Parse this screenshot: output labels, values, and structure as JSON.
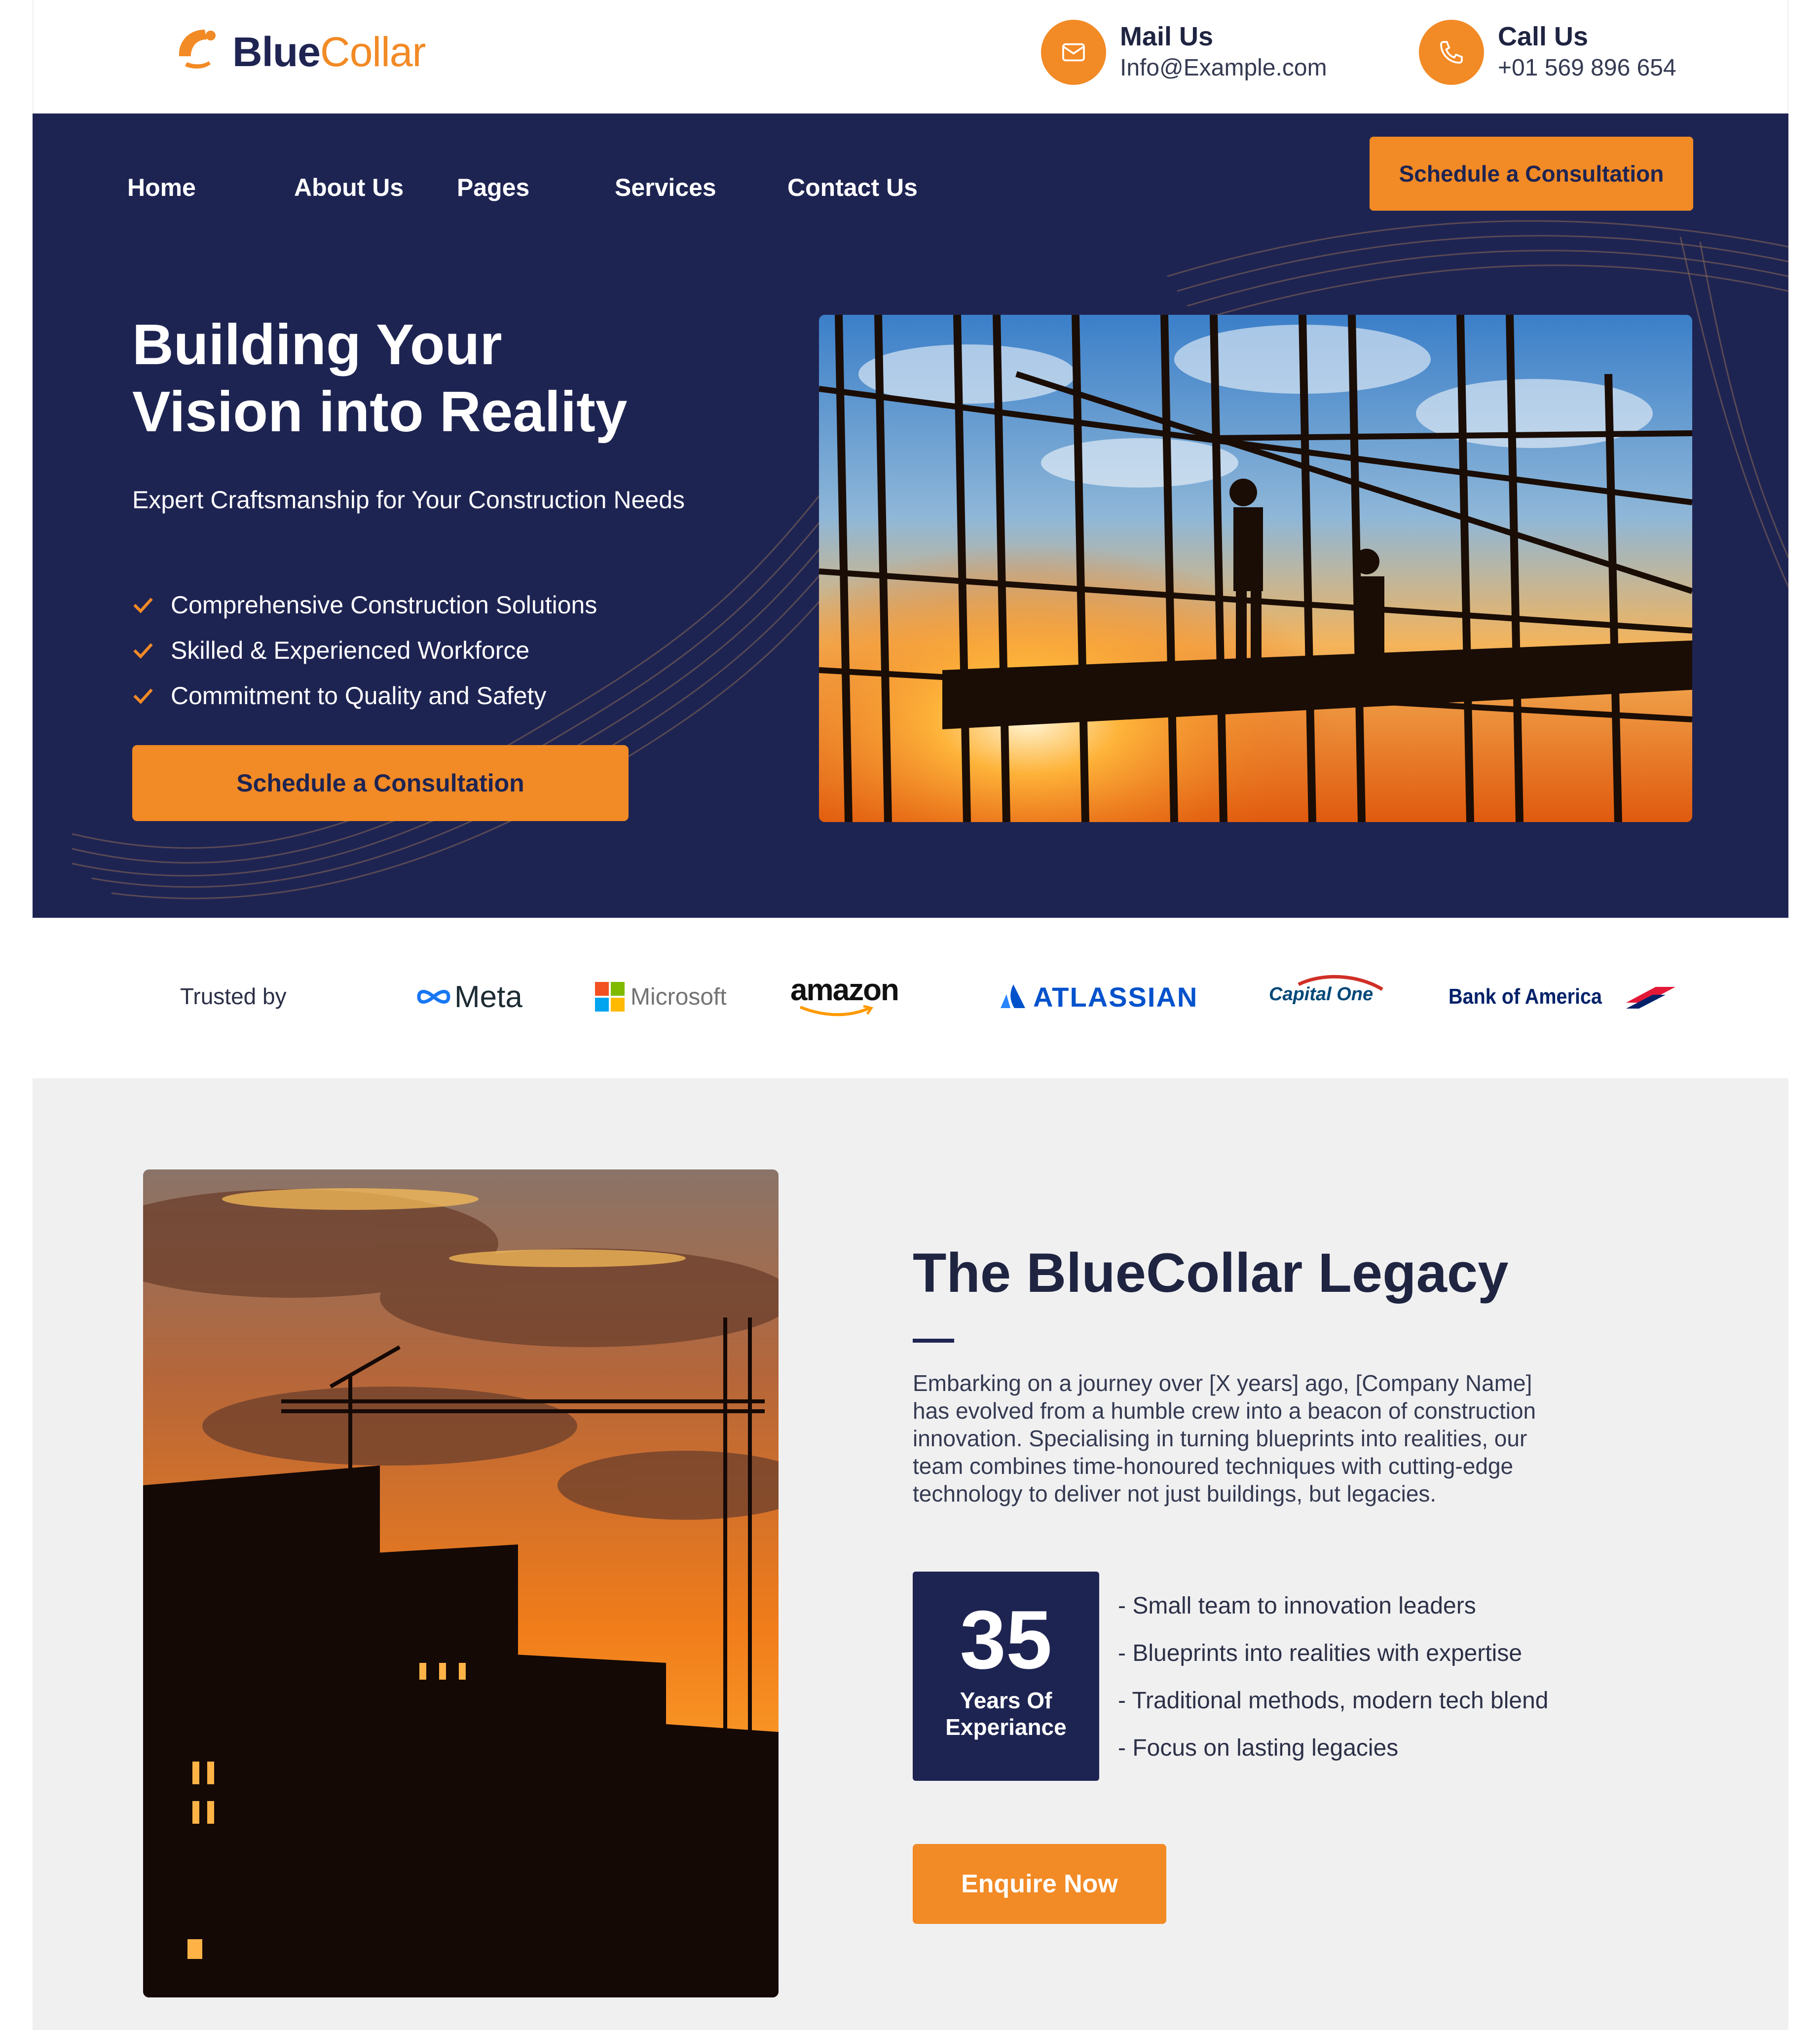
{
  "header": {
    "logo": {
      "part1": "Blue",
      "part2": "Collar"
    },
    "mail": {
      "title": "Mail Us",
      "value": "Info@Example.com",
      "icon": "mail-icon"
    },
    "call": {
      "title": "Call Us",
      "value": "+01 569 896 654",
      "icon": "phone-icon"
    }
  },
  "nav": {
    "items": [
      {
        "label": "Home"
      },
      {
        "label": "About Us"
      },
      {
        "label": "Pages"
      },
      {
        "label": "Services"
      },
      {
        "label": "Contact Us"
      }
    ],
    "cta": "Schedule a Consultation"
  },
  "hero": {
    "title_line1": "Building Your",
    "title_line2": "Vision into Reality",
    "subtitle": "Expert Craftsmanship for Your Construction Needs",
    "checklist": [
      "Comprehensive Construction Solutions",
      "Skilled & Experienced Workforce",
      "Commitment to Quality and Safety"
    ],
    "cta": "Schedule a Consultation"
  },
  "trusted": {
    "label": "Trusted by",
    "brands": [
      "Meta",
      "Microsoft",
      "amazon",
      "ATLASSIAN",
      "Capital One",
      "Bank of America"
    ]
  },
  "legacy": {
    "title": "The BlueCollar Legacy",
    "body": "Embarking on a journey over [X years] ago, [Company Name] has evolved from a humble crew into a beacon of construction innovation. Specialising in turning blueprints into realities, our team combines time-honoured techniques with cutting-edge technology to deliver not just buildings, but legacies.",
    "stat_number": "35",
    "stat_label_line1": "Years Of",
    "stat_label_line2": "Experiance",
    "bullets": [
      "- Small team to innovation leaders",
      "- Blueprints into realities with expertise",
      "- Traditional methods, modern tech blend",
      "- Focus on lasting legacies"
    ],
    "cta": "Enquire Now"
  },
  "colors": {
    "navy": "#1e2452",
    "orange": "#f28a25",
    "light_gray": "#f0f0f1"
  }
}
